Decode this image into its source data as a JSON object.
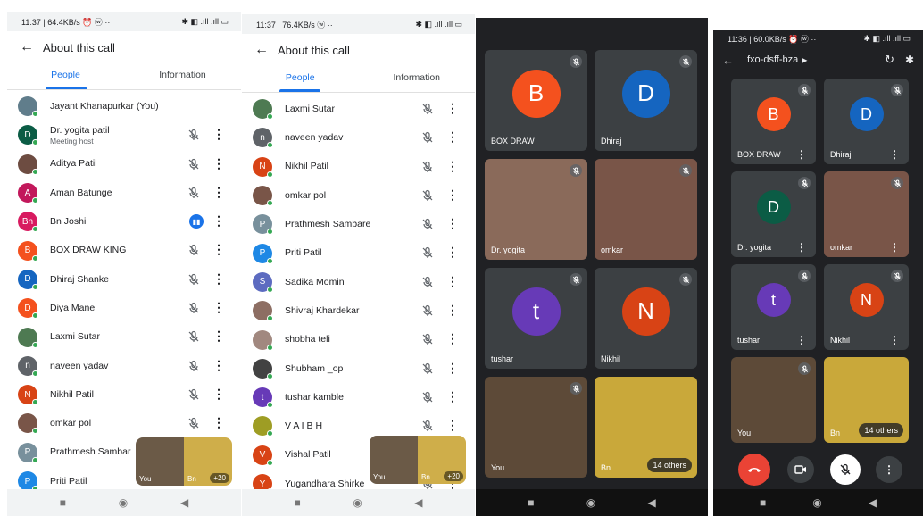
{
  "panel1": {
    "status_left": "11:37 | 64.4KB/s ⏰ ⓦ ··",
    "status_right": "✱ ◧ .ıll .ıll ▭",
    "title": "About this call",
    "tabs": [
      "People",
      "Information"
    ],
    "people": [
      {
        "name": "Jayant Khanapurkar (You)",
        "initial": "",
        "color": "#607d8b",
        "sub": "",
        "mic_off": false,
        "more": false
      },
      {
        "name": "Dr. yogita patil",
        "initial": "D",
        "color": "#0b5c45",
        "sub": "Meeting host",
        "mic_off": true,
        "more": true
      },
      {
        "name": "Aditya Patil",
        "initial": "",
        "color": "#6d4c41",
        "sub": "",
        "mic_off": true,
        "more": true
      },
      {
        "name": "Aman Batunge",
        "initial": "A",
        "color": "#c2185b",
        "sub": "",
        "mic_off": true,
        "more": true
      },
      {
        "name": "Bn Joshi",
        "initial": "Bn",
        "color": "#d81b60",
        "sub": "",
        "mic_off": false,
        "talking": true,
        "more": true
      },
      {
        "name": "BOX DRAW KING",
        "initial": "B",
        "color": "#f4511e",
        "sub": "",
        "mic_off": true,
        "more": true
      },
      {
        "name": "Dhiraj Shanke",
        "initial": "D",
        "color": "#1565c0",
        "sub": "",
        "mic_off": true,
        "more": true
      },
      {
        "name": "Diya Mane",
        "initial": "D",
        "color": "#f4511e",
        "sub": "",
        "mic_off": true,
        "more": true
      },
      {
        "name": "Laxmi Sutar",
        "initial": "",
        "color": "#4e7a52",
        "sub": "",
        "mic_off": true,
        "more": true
      },
      {
        "name": "naveen yadav",
        "initial": "n",
        "color": "#5f6368",
        "sub": "",
        "mic_off": true,
        "more": true
      },
      {
        "name": "Nikhil Patil",
        "initial": "N",
        "color": "#d84315",
        "sub": "",
        "mic_off": true,
        "more": true
      },
      {
        "name": "omkar pol",
        "initial": "",
        "color": "#795548",
        "sub": "",
        "mic_off": true,
        "more": true
      },
      {
        "name": "Prathmesh Sambar",
        "initial": "P",
        "color": "#78909c",
        "sub": "",
        "mic_off": false,
        "more": false
      },
      {
        "name": "Priti Patil",
        "initial": "P",
        "color": "#1e88e5",
        "sub": "",
        "mic_off": false,
        "more": false
      }
    ],
    "pip": {
      "you": "You",
      "bn": "Bn",
      "count": "+20"
    },
    "nav": [
      "■",
      "◉",
      "◀"
    ]
  },
  "panel2": {
    "status_left": "11:37 | 76.4KB/s ⓦ ··",
    "status_right": "✱ ◧ .ıll .ıll ▭",
    "title": "About this call",
    "tabs": [
      "People",
      "Information"
    ],
    "people": [
      {
        "name": "Laxmi Sutar",
        "initial": "",
        "color": "#4e7a52"
      },
      {
        "name": "naveen yadav",
        "initial": "n",
        "color": "#5f6368"
      },
      {
        "name": "Nikhil Patil",
        "initial": "N",
        "color": "#d84315"
      },
      {
        "name": "omkar pol",
        "initial": "",
        "color": "#795548"
      },
      {
        "name": "Prathmesh Sambare",
        "initial": "P",
        "color": "#78909c"
      },
      {
        "name": "Priti Patil",
        "initial": "P",
        "color": "#1e88e5"
      },
      {
        "name": "Sadika Momin",
        "initial": "S",
        "color": "#5c6bc0"
      },
      {
        "name": "Shivraj Khardekar",
        "initial": "",
        "color": "#8d6e63"
      },
      {
        "name": "shobha teli",
        "initial": "",
        "color": "#a1887f"
      },
      {
        "name": "Shubham _op",
        "initial": "",
        "color": "#424242"
      },
      {
        "name": "tushar kamble",
        "initial": "t",
        "color": "#673ab7"
      },
      {
        "name": "V A I B H",
        "initial": "",
        "color": "#9e9d24"
      },
      {
        "name": "Vishal Patil",
        "initial": "V",
        "color": "#d84315"
      },
      {
        "name": "Yugandhara Shirke",
        "initial": "Y",
        "color": "#d84315"
      }
    ],
    "pip": {
      "you": "You",
      "bn": "Bn",
      "count": "+20"
    },
    "nav": [
      "■",
      "◉",
      "◀"
    ]
  },
  "panel3": {
    "tiles": [
      {
        "name": "BOX DRAW",
        "initial": "B",
        "color": "#f4511e"
      },
      {
        "name": "Dhiraj",
        "initial": "D",
        "color": "#1565c0"
      },
      {
        "name": "Dr. yogita",
        "initial": "",
        "color": "#8a6a5a"
      },
      {
        "name": "omkar",
        "initial": "",
        "color": "#795548"
      },
      {
        "name": "tushar",
        "initial": "t",
        "color": "#673ab7"
      },
      {
        "name": "Nikhil",
        "initial": "N",
        "color": "#d84315"
      },
      {
        "name": "You",
        "initial": "",
        "color": "#5d4a38"
      },
      {
        "name": "Bn",
        "initial": "",
        "color": "#c9a83a"
      }
    ],
    "others": "14 others",
    "nav": [
      "■",
      "◉",
      "◀"
    ]
  },
  "panel4": {
    "status_left": "11:36 | 60.0KB/s ⏰ ⓦ ··",
    "status_right": "✱ ◧ .ıll .ıll ▭",
    "meeting_code": "fxo-dsff-bza",
    "tiles": [
      {
        "name": "BOX DRAW",
        "initial": "B",
        "color": "#f4511e"
      },
      {
        "name": "Dhiraj",
        "initial": "D",
        "color": "#1565c0"
      },
      {
        "name": "Dr. yogita",
        "initial": "D",
        "color": "#0b5c45"
      },
      {
        "name": "omkar",
        "initial": "",
        "color": "#795548"
      },
      {
        "name": "tushar",
        "initial": "t",
        "color": "#673ab7"
      },
      {
        "name": "Nikhil",
        "initial": "N",
        "color": "#d84315"
      },
      {
        "name": "You",
        "initial": "",
        "color": "#5d4a38"
      },
      {
        "name": "Bn",
        "initial": "",
        "color": "#c9a83a"
      }
    ],
    "others": "14 others",
    "nav": [
      "■",
      "◉",
      "◀"
    ]
  },
  "colors": {
    "accent": "#1a73e8",
    "end_call": "#ea4335",
    "online": "#34a853"
  }
}
